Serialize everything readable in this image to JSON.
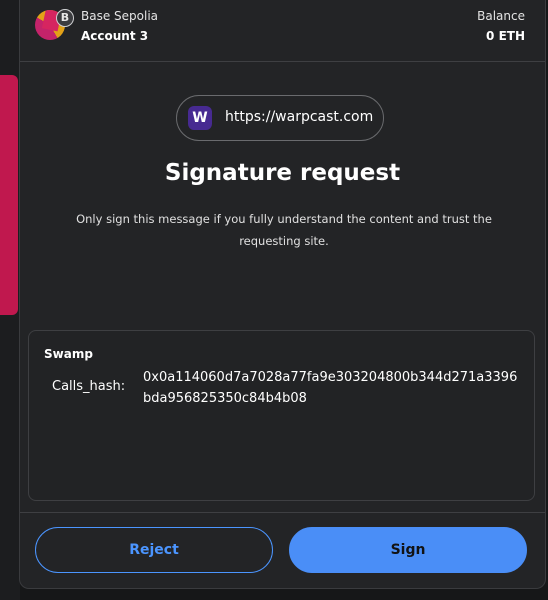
{
  "header": {
    "network_badge": "B",
    "network_name": "Base Sepolia",
    "account_name": "Account 3",
    "balance_label": "Balance",
    "balance_value": "0 ETH"
  },
  "origin": {
    "icon_letter": "W",
    "url": "https://warpcast.com"
  },
  "request": {
    "title": "Signature request",
    "subtitle": "Only sign this message if you fully understand the content and trust the requesting site."
  },
  "message": {
    "type": "Swamp",
    "field_key": "Calls_hash:",
    "field_value": "0x0a114060d7a7028a77fa9e303204800b344d271a3396bda956825350c84b4b08"
  },
  "actions": {
    "reject_label": "Reject",
    "sign_label": "Sign"
  },
  "colors": {
    "accent": "#4a8ef7",
    "background": "#232426",
    "avatar_primary": "#d62560",
    "avatar_secondary": "#e2a117",
    "origin_icon_bg": "#472a91"
  }
}
